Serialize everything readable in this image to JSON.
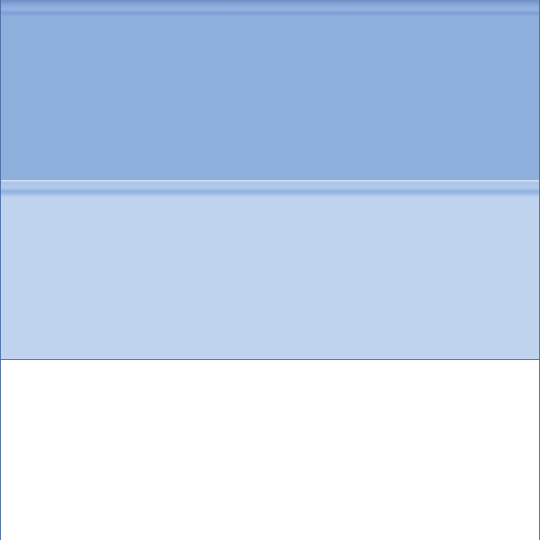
{
  "colors": {
    "frame_border": "#4a6ea8",
    "band_top": "#8cafdc",
    "band_middle": "#bfd3ee",
    "band_bottom": "#ffffff"
  },
  "panels": [
    {
      "id": "top-panel",
      "label": ""
    },
    {
      "id": "middle-panel",
      "label": ""
    },
    {
      "id": "bottom-panel",
      "label": ""
    }
  ]
}
